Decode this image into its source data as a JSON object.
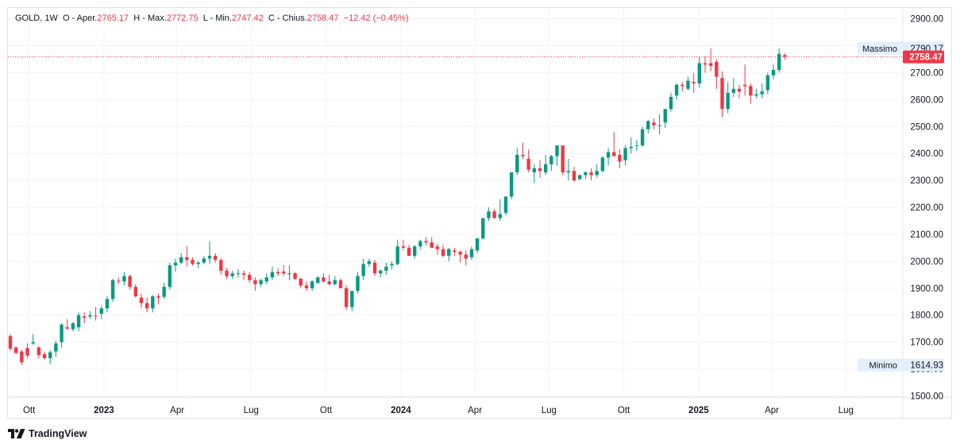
{
  "legend": {
    "symbol": "GOLD",
    "interval": "1W",
    "open_label": "O - Aper.",
    "open_value": "2765.17",
    "high_label": "H - Max.",
    "high_value": "2772.75",
    "low_label": "L - Min.",
    "low_value": "2747.42",
    "close_label": "C - Chius.",
    "close_value": "2758.47",
    "change": "−12.42 (−0.45%)"
  },
  "brand": "TradingView",
  "colors": {
    "up": "#089981",
    "down": "#f23645",
    "grid": "#f0f3fa",
    "axis_text": "#131722",
    "badge_bg": "#e3effd"
  },
  "chart_data": {
    "type": "candlestick",
    "interval": "1W",
    "ylim": [
      1500,
      2900
    ],
    "y_ticks": [
      1500,
      1600,
      1700,
      1800,
      1900,
      2000,
      2100,
      2200,
      2300,
      2400,
      2500,
      2600,
      2700,
      2800,
      2900
    ],
    "y_tick_labels": [
      "1500.00",
      "1600.00",
      "1700.00",
      "1800.00",
      "1900.00",
      "2000.00",
      "2100.00",
      "2200.00",
      "2300.00",
      "2400.00",
      "2500.00",
      "2600.00",
      "2700.00",
      "2800.00",
      "2900.00"
    ],
    "x_range": [
      "2022-09-05",
      "2025-09-08"
    ],
    "x_ticks": [
      {
        "label": "Ott",
        "date": "2022-10-01",
        "bold": false
      },
      {
        "label": "2023",
        "date": "2023-01-01",
        "bold": true
      },
      {
        "label": "Apr",
        "date": "2023-04-01",
        "bold": false
      },
      {
        "label": "Lug",
        "date": "2023-07-01",
        "bold": false
      },
      {
        "label": "Ott",
        "date": "2023-10-01",
        "bold": false
      },
      {
        "label": "2024",
        "date": "2024-01-01",
        "bold": true
      },
      {
        "label": "Apr",
        "date": "2024-04-01",
        "bold": false
      },
      {
        "label": "Lug",
        "date": "2024-07-01",
        "bold": false
      },
      {
        "label": "Ott",
        "date": "2024-10-01",
        "bold": false
      },
      {
        "label": "2025",
        "date": "2025-01-01",
        "bold": true
      },
      {
        "label": "Apr",
        "date": "2025-04-01",
        "bold": false
      },
      {
        "label": "Lug",
        "date": "2025-07-01",
        "bold": false
      }
    ],
    "markers": {
      "max": {
        "label": "Massimo",
        "value": "2790.17"
      },
      "min": {
        "label": "Minimo",
        "value": "1614.93"
      },
      "last": {
        "value": "2758.47",
        "price": 2758.47
      }
    },
    "first_week": "2022-09-05",
    "candles": [
      [
        1722,
        1730,
        1668,
        1675
      ],
      [
        1680,
        1685,
        1655,
        1660
      ],
      [
        1665,
        1672,
        1615,
        1625
      ],
      [
        1678,
        1695,
        1640,
        1650
      ],
      [
        1695,
        1730,
        1690,
        1700
      ],
      [
        1680,
        1685,
        1640,
        1652
      ],
      [
        1655,
        1665,
        1635,
        1640
      ],
      [
        1640,
        1670,
        1618,
        1662
      ],
      [
        1665,
        1705,
        1645,
        1695
      ],
      [
        1700,
        1770,
        1680,
        1765
      ],
      [
        1755,
        1785,
        1745,
        1750
      ],
      [
        1748,
        1775,
        1740,
        1770
      ],
      [
        1755,
        1810,
        1740,
        1800
      ],
      [
        1795,
        1810,
        1770,
        1790
      ],
      [
        1795,
        1815,
        1785,
        1800
      ],
      [
        1798,
        1830,
        1780,
        1795
      ],
      [
        1805,
        1835,
        1785,
        1825
      ],
      [
        1825,
        1870,
        1810,
        1860
      ],
      [
        1860,
        1935,
        1850,
        1930
      ],
      [
        1928,
        1940,
        1915,
        1925
      ],
      [
        1925,
        1960,
        1910,
        1945
      ],
      [
        1945,
        1950,
        1895,
        1905
      ],
      [
        1905,
        1915,
        1865,
        1870
      ],
      [
        1865,
        1880,
        1825,
        1845
      ],
      [
        1845,
        1865,
        1810,
        1825
      ],
      [
        1825,
        1875,
        1810,
        1870
      ],
      [
        1870,
        1880,
        1840,
        1865
      ],
      [
        1868,
        1920,
        1860,
        1905
      ],
      [
        1905,
        1995,
        1895,
        1985
      ],
      [
        1985,
        2010,
        1960,
        1995
      ],
      [
        1995,
        2030,
        1990,
        2015
      ],
      [
        2015,
        2055,
        1980,
        2005
      ],
      [
        2005,
        2015,
        1985,
        1990
      ],
      [
        1990,
        2000,
        1975,
        1995
      ],
      [
        1995,
        2020,
        1990,
        2010
      ],
      [
        2010,
        2075,
        1990,
        2020
      ],
      [
        2020,
        2030,
        1995,
        2005
      ],
      [
        2005,
        2010,
        1950,
        1965
      ],
      [
        1965,
        1975,
        1935,
        1945
      ],
      [
        1945,
        1965,
        1935,
        1955
      ],
      [
        1955,
        1970,
        1940,
        1955
      ],
      [
        1955,
        1965,
        1930,
        1950
      ],
      [
        1950,
        1960,
        1920,
        1930
      ],
      [
        1930,
        1940,
        1890,
        1915
      ],
      [
        1915,
        1935,
        1905,
        1930
      ],
      [
        1925,
        1955,
        1915,
        1940
      ],
      [
        1940,
        1980,
        1930,
        1960
      ],
      [
        1960,
        1975,
        1945,
        1955
      ],
      [
        1962,
        1985,
        1945,
        1955
      ],
      [
        1955,
        1985,
        1930,
        1955
      ],
      [
        1955,
        1960,
        1930,
        1935
      ],
      [
        1935,
        1940,
        1900,
        1910
      ],
      [
        1910,
        1925,
        1890,
        1900
      ],
      [
        1900,
        1930,
        1890,
        1925
      ],
      [
        1920,
        1945,
        1915,
        1940
      ],
      [
        1940,
        1955,
        1920,
        1925
      ],
      [
        1925,
        1950,
        1910,
        1915
      ],
      [
        1915,
        1945,
        1910,
        1930
      ],
      [
        1930,
        1935,
        1900,
        1900
      ],
      [
        1900,
        1910,
        1820,
        1830
      ],
      [
        1830,
        1880,
        1815,
        1890
      ],
      [
        1890,
        1960,
        1880,
        1945
      ],
      [
        1945,
        2010,
        1930,
        1990
      ],
      [
        1990,
        2010,
        1980,
        2000
      ],
      [
        1995,
        2005,
        1945,
        1955
      ],
      [
        1955,
        1970,
        1940,
        1965
      ],
      [
        1965,
        1995,
        1950,
        1980
      ],
      [
        1985,
        2000,
        1970,
        1990
      ],
      [
        1990,
        2080,
        1985,
        2055
      ],
      [
        2055,
        2080,
        2040,
        2050
      ],
      [
        2050,
        2060,
        2020,
        2020
      ],
      [
        2020,
        2060,
        2010,
        2055
      ],
      [
        2055,
        2080,
        2045,
        2075
      ],
      [
        2075,
        2090,
        2060,
        2070
      ],
      [
        2070,
        2090,
        2060,
        2050
      ],
      [
        2055,
        2065,
        2025,
        2045
      ],
      [
        2045,
        2060,
        2015,
        2020
      ],
      [
        2020,
        2050,
        2000,
        2045
      ],
      [
        2040,
        2050,
        2020,
        2035
      ],
      [
        2035,
        2040,
        1995,
        2025
      ],
      [
        2025,
        2040,
        1985,
        2010
      ],
      [
        2015,
        2055,
        2005,
        2045
      ],
      [
        2040,
        2085,
        2030,
        2085
      ],
      [
        2085,
        2160,
        2080,
        2160
      ],
      [
        2160,
        2200,
        2150,
        2185
      ],
      [
        2185,
        2195,
        2160,
        2160
      ],
      [
        2160,
        2230,
        2150,
        2175
      ],
      [
        2180,
        2240,
        2170,
        2240
      ],
      [
        2240,
        2320,
        2230,
        2330
      ],
      [
        2330,
        2420,
        2320,
        2395
      ],
      [
        2395,
        2440,
        2380,
        2390
      ],
      [
        2380,
        2415,
        2330,
        2340
      ],
      [
        2330,
        2360,
        2290,
        2345
      ],
      [
        2345,
        2375,
        2310,
        2335
      ],
      [
        2330,
        2395,
        2320,
        2360
      ],
      [
        2360,
        2395,
        2335,
        2390
      ],
      [
        2390,
        2425,
        2355,
        2430
      ],
      [
        2430,
        2430,
        2320,
        2330
      ],
      [
        2330,
        2380,
        2300,
        2335
      ],
      [
        2335,
        2350,
        2295,
        2300
      ],
      [
        2305,
        2320,
        2300,
        2320
      ],
      [
        2320,
        2335,
        2305,
        2330
      ],
      [
        2330,
        2345,
        2300,
        2320
      ],
      [
        2320,
        2360,
        2310,
        2335
      ],
      [
        2335,
        2390,
        2330,
        2385
      ],
      [
        2385,
        2420,
        2355,
        2405
      ],
      [
        2405,
        2480,
        2400,
        2390
      ],
      [
        2395,
        2415,
        2345,
        2370
      ],
      [
        2375,
        2430,
        2355,
        2420
      ],
      [
        2420,
        2460,
        2400,
        2425
      ],
      [
        2430,
        2450,
        2410,
        2430
      ],
      [
        2430,
        2500,
        2425,
        2490
      ],
      [
        2490,
        2525,
        2475,
        2520
      ],
      [
        2515,
        2530,
        2490,
        2505
      ],
      [
        2505,
        2545,
        2470,
        2505
      ],
      [
        2515,
        2565,
        2495,
        2565
      ],
      [
        2565,
        2625,
        2555,
        2610
      ],
      [
        2615,
        2660,
        2600,
        2655
      ],
      [
        2655,
        2665,
        2630,
        2650
      ],
      [
        2640,
        2685,
        2635,
        2670
      ],
      [
        2665,
        2700,
        2625,
        2660
      ],
      [
        2660,
        2760,
        2645,
        2735
      ],
      [
        2735,
        2760,
        2700,
        2730
      ],
      [
        2735,
        2790,
        2705,
        2725
      ],
      [
        2740,
        2750,
        2640,
        2685
      ],
      [
        2680,
        2705,
        2535,
        2565
      ],
      [
        2565,
        2665,
        2550,
        2625
      ],
      [
        2625,
        2680,
        2610,
        2640
      ],
      [
        2640,
        2655,
        2605,
        2630
      ],
      [
        2655,
        2730,
        2615,
        2650
      ],
      [
        2650,
        2660,
        2585,
        2615
      ],
      [
        2615,
        2640,
        2605,
        2620
      ],
      [
        2620,
        2660,
        2605,
        2630
      ],
      [
        2635,
        2700,
        2620,
        2690
      ],
      [
        2690,
        2730,
        2675,
        2710
      ],
      [
        2710,
        2790,
        2700,
        2770
      ],
      [
        2765.17,
        2772.75,
        2747.42,
        2758.47
      ]
    ]
  }
}
